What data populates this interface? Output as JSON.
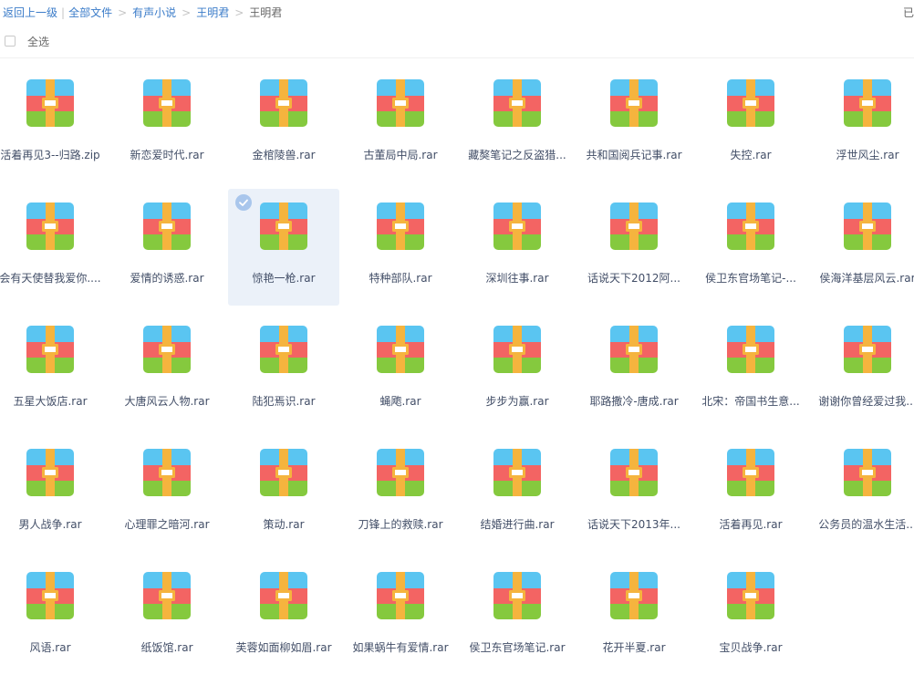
{
  "breadcrumb": {
    "back": "返回上一级",
    "all_files": "全部文件",
    "path": [
      "有声小说",
      "王明君"
    ],
    "current": "王明君"
  },
  "top_right_text": "已",
  "select_all_label": "全选",
  "colors": {
    "link": "#3b7cc9",
    "text": "#424e67",
    "selected_bg": "#ebf1f9",
    "icon_blue": "#5ac5f1",
    "icon_red": "#f36463",
    "icon_green": "#85c93e",
    "icon_belt": "#f5b43e"
  },
  "file_icon": "archive-rar-icon",
  "files": [
    {
      "name": "活着再见3--归路.zip",
      "selected": false
    },
    {
      "name": "新恋爱时代.rar",
      "selected": false
    },
    {
      "name": "金棺陵兽.rar",
      "selected": false
    },
    {
      "name": "古董局中局.rar",
      "selected": false
    },
    {
      "name": "藏獒笔记之反盗猎...",
      "selected": false
    },
    {
      "name": "共和国阅兵记事.rar",
      "selected": false
    },
    {
      "name": "失控.rar",
      "selected": false
    },
    {
      "name": "浮世风尘.rar",
      "selected": false
    },
    {
      "name": "会有天使替我爱你....",
      "selected": false
    },
    {
      "name": "爱情的诱惑.rar",
      "selected": false
    },
    {
      "name": "惊艳一枪.rar",
      "selected": true
    },
    {
      "name": "特种部队.rar",
      "selected": false
    },
    {
      "name": "深圳往事.rar",
      "selected": false
    },
    {
      "name": "话说天下2012阿...",
      "selected": false
    },
    {
      "name": "侯卫东官场笔记-...",
      "selected": false
    },
    {
      "name": "侯海洋基层风云.rar",
      "selected": false
    },
    {
      "name": "五星大饭店.rar",
      "selected": false
    },
    {
      "name": "大唐风云人物.rar",
      "selected": false
    },
    {
      "name": "陆犯焉识.rar",
      "selected": false
    },
    {
      "name": "蝇飑.rar",
      "selected": false
    },
    {
      "name": "步步为赢.rar",
      "selected": false
    },
    {
      "name": "耶路撒冷-唐成.rar",
      "selected": false
    },
    {
      "name": "北宋：帝国书生意...",
      "selected": false
    },
    {
      "name": "谢谢你曾经爱过我...",
      "selected": false
    },
    {
      "name": "男人战争.rar",
      "selected": false
    },
    {
      "name": "心理罪之暗河.rar",
      "selected": false
    },
    {
      "name": "策动.rar",
      "selected": false
    },
    {
      "name": "刀锋上的救赎.rar",
      "selected": false
    },
    {
      "name": "结婚进行曲.rar",
      "selected": false
    },
    {
      "name": "话说天下2013年...",
      "selected": false
    },
    {
      "name": "活着再见.rar",
      "selected": false
    },
    {
      "name": "公务员的温水生活...",
      "selected": false
    },
    {
      "name": "风语.rar",
      "selected": false
    },
    {
      "name": "纸饭馆.rar",
      "selected": false
    },
    {
      "name": "芙蓉如面柳如眉.rar",
      "selected": false
    },
    {
      "name": "如果蜗牛有爱情.rar",
      "selected": false
    },
    {
      "name": "侯卫东官场笔记.rar",
      "selected": false
    },
    {
      "name": "花开半夏.rar",
      "selected": false
    },
    {
      "name": "宝贝战争.rar",
      "selected": false
    }
  ]
}
